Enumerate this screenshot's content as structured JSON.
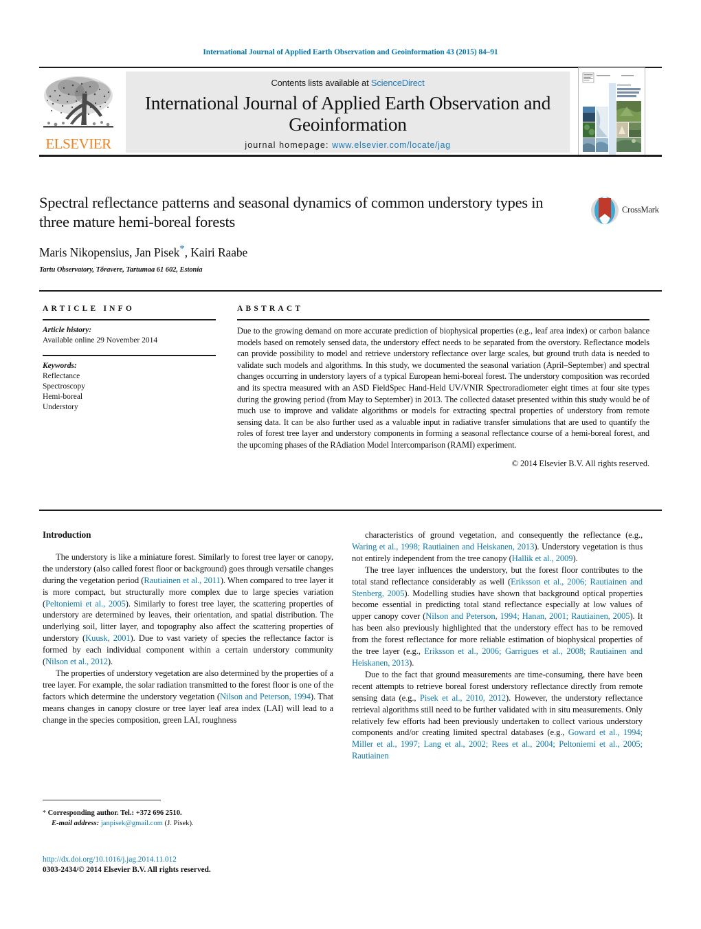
{
  "running_head": "International Journal of Applied Earth Observation and Geoinformation 43 (2015) 84–91",
  "masthead": {
    "contents_prefix": "Contents lists available at ",
    "sciencedirect": "ScienceDirect",
    "journal_title": "International Journal of Applied Earth Observation and Geoinformation",
    "homepage_label": "journal homepage:",
    "homepage_url": "www.elsevier.com/locate/jag",
    "publisher": "ELSEVIER"
  },
  "article": {
    "title": "Spectral reflectance patterns and seasonal dynamics of common understory types in three mature hemi-boreal forests",
    "authors_part1": "Maris Nikopensius, Jan Pisek",
    "authors_star": "*",
    "authors_part2": ", Kairi Raabe",
    "affiliation": "Tartu Observatory, Tõravere, Tartumaa 61 602, Estonia",
    "crossmark_label": "CrossMark"
  },
  "article_info": {
    "heading": "ARTICLE INFO",
    "history_label": "Article history:",
    "history_value": "Available online 29 November 2014",
    "keywords_label": "Keywords:",
    "keywords": [
      "Reflectance",
      "Spectroscopy",
      "Hemi-boreal",
      "Understory"
    ]
  },
  "abstract": {
    "heading": "ABSTRACT",
    "text": "Due to the growing demand on more accurate prediction of biophysical properties (e.g., leaf area index) or carbon balance models based on remotely sensed data, the understory effect needs to be separated from the overstory. Reflectance models can provide possibility to model and retrieve understory reflectance over large scales, but ground truth data is needed to validate such models and algorithms. In this study, we documented the seasonal variation (April–September) and spectral changes occurring in understory layers of a typical European hemi-boreal forest. The understory composition was recorded and its spectra measured with an ASD FieldSpec Hand-Held UV/VNIR Spectroradiometer eight times at four site types during the growing period (from May to September) in 2013. The collected dataset presented within this study would be of much use to improve and validate algorithms or models for extracting spectral properties of understory from remote sensing data. It can be also further used as a valuable input in radiative transfer simulations that are used to quantify the roles of forest tree layer and understory components in forming a seasonal reflectance course of a hemi-boreal forest, and the upcoming phases of the RAdiation Model Intercomparison (RAMI) experiment.",
    "copyright": "© 2014 Elsevier B.V. All rights reserved."
  },
  "body": {
    "section_heading": "Introduction",
    "left_paragraphs": [
      {
        "segments": [
          {
            "t": "The understory is like a miniature forest. Similarly to forest tree layer or canopy, the understory (also called forest floor or background) goes through versatile changes during the vegetation period (",
            "ref": false
          },
          {
            "t": "Rautiainen et al., 2011",
            "ref": true
          },
          {
            "t": "). When compared to tree layer it is more compact, but structurally more complex due to large species variation (",
            "ref": false
          },
          {
            "t": "Peltoniemi et al., 2005",
            "ref": true
          },
          {
            "t": "). Similarly to forest tree layer, the scattering properties of understory are determined by leaves, their orientation, and spatial distribution. The underlying soil, litter layer, and topography also affect the scattering properties of understory (",
            "ref": false
          },
          {
            "t": "Kuusk, 2001",
            "ref": true
          },
          {
            "t": "). Due to vast variety of species the reflectance factor is formed by each individual component within a certain understory community (",
            "ref": false
          },
          {
            "t": "Nilson et al., 2012",
            "ref": true
          },
          {
            "t": ").",
            "ref": false
          }
        ]
      },
      {
        "segments": [
          {
            "t": "The properties of understory vegetation are also determined by the properties of a tree layer. For example, the solar radiation transmitted to the forest floor is one of the factors which determine the understory vegetation (",
            "ref": false
          },
          {
            "t": "Nilson and Peterson, 1994",
            "ref": true
          },
          {
            "t": "). That means changes in canopy closure or tree layer leaf area index (LAI) will lead to a change in the species composition, green LAI, roughness",
            "ref": false
          }
        ]
      }
    ],
    "right_paragraphs": [
      {
        "segments": [
          {
            "t": "characteristics of ground vegetation, and consequently the reflectance (e.g., ",
            "ref": false
          },
          {
            "t": "Waring et al., 1998; Rautiainen and Heiskanen, 2013",
            "ref": true
          },
          {
            "t": "). Understory vegetation is thus not entirely independent from the tree canopy (",
            "ref": false
          },
          {
            "t": "Hallik et al., 2009",
            "ref": true
          },
          {
            "t": ").",
            "ref": false
          }
        ]
      },
      {
        "segments": [
          {
            "t": "The tree layer influences the understory, but the forest floor contributes to the total stand reflectance considerably as well (",
            "ref": false
          },
          {
            "t": "Eriksson et al., 2006; Rautiainen and Stenberg, 2005",
            "ref": true
          },
          {
            "t": "). Modelling studies have shown that background optical properties become essential in predicting total stand reflectance especially at low values of upper canopy cover (",
            "ref": false
          },
          {
            "t": "Nilson and Peterson, 1994; Hanan, 2001; Rautiainen, 2005",
            "ref": true
          },
          {
            "t": "). It has been also previously highlighted that the understory effect has to be removed from the forest reflectance for more reliable estimation of biophysical properties of the tree layer (e.g., ",
            "ref": false
          },
          {
            "t": "Eriksson et al., 2006; Garrigues et al., 2008; Rautiainen and Heiskanen, 2013",
            "ref": true
          },
          {
            "t": ").",
            "ref": false
          }
        ]
      },
      {
        "segments": [
          {
            "t": "Due to the fact that ground measurements are time-consuming, there have been recent attempts to retrieve boreal forest understory reflectance directly from remote sensing data (e.g., ",
            "ref": false
          },
          {
            "t": "Pisek et al., 2010, 2012",
            "ref": true
          },
          {
            "t": "). However, the understory reflectance retrieval algorithms still need to be further validated with in situ measurements. Only relatively few efforts had been previously undertaken to collect various understory components and/or creating limited spectral databases (e.g., ",
            "ref": false
          },
          {
            "t": "Goward et al., 1994; Miller et al., 1997; Lang et al., 2002; Rees et al., 2004; Peltoniemi et al., 2005; Rautiainen",
            "ref": true
          }
        ]
      }
    ]
  },
  "footnote": {
    "star": "*",
    "corresponding": "Corresponding author. Tel.: +372 696 2510.",
    "email_label": "E-mail address:",
    "email": "janpisek@gmail.com",
    "email_owner": "(J. Pisek)."
  },
  "footer": {
    "doi": "http://dx.doi.org/10.1016/j.jag.2014.11.012",
    "issn_line": "0303-2434/© 2014 Elsevier B.V. All rights reserved."
  },
  "colors": {
    "link_blue": "#1278a8",
    "sciencedirect_blue": "#1f7bb6",
    "elsevier_orange": "#e8842a",
    "band_gray": "#e9e9e9",
    "crossmark_red": "#c0392b",
    "crossmark_blue": "#3fa9d6"
  }
}
